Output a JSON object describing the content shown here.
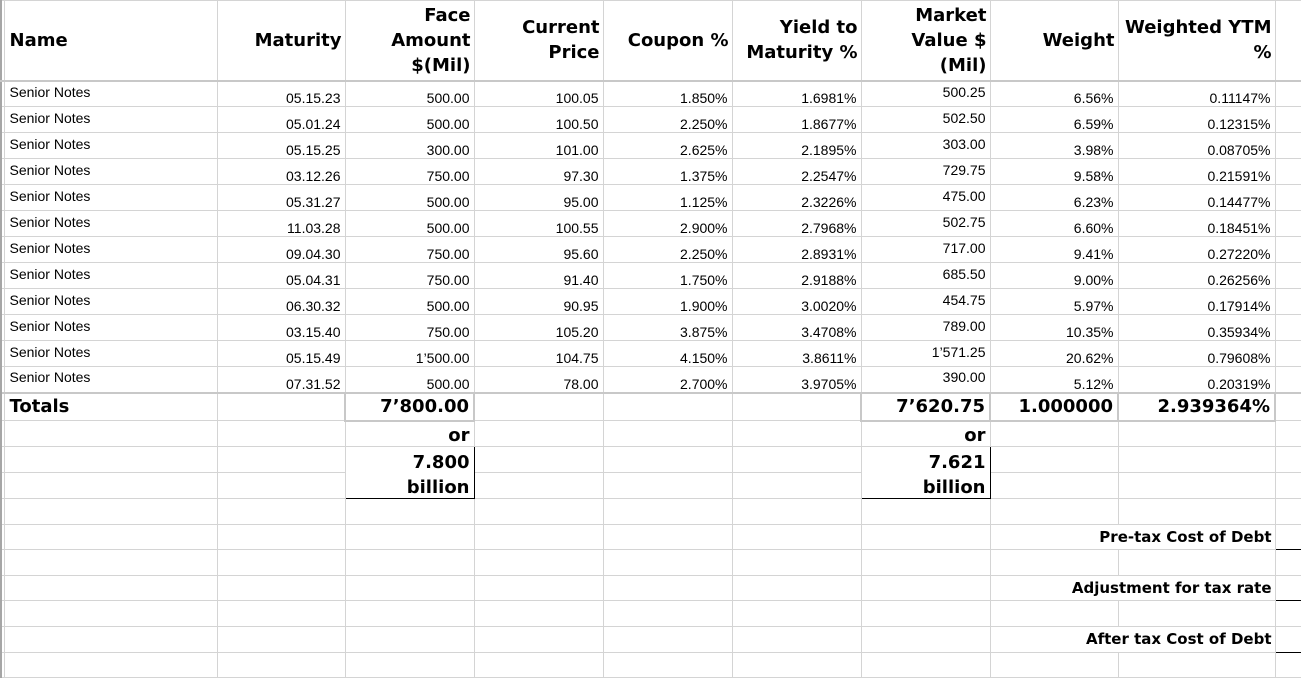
{
  "headers": {
    "name": "Name",
    "maturity": "Maturity",
    "face_amount": "Face Amount $(Mil)",
    "current_price": "Current Price",
    "coupon": "Coupon %",
    "ytm": "Yield to Maturity %",
    "market_value": "Market Value $ (Mil)",
    "weight": "Weight",
    "weighted_ytm": "Weighted YTM %"
  },
  "rows": [
    {
      "name": "Senior Notes",
      "maturity": "05.15.23",
      "face": "500.00",
      "price": "100.05",
      "coupon": "1.850%",
      "ytm": "1.6981%",
      "mv": "500.25",
      "weight": "6.56%",
      "wytm": "0.11147%"
    },
    {
      "name": "Senior Notes",
      "maturity": "05.01.24",
      "face": "500.00",
      "price": "100.50",
      "coupon": "2.250%",
      "ytm": "1.8677%",
      "mv": "502.50",
      "weight": "6.59%",
      "wytm": "0.12315%"
    },
    {
      "name": "Senior Notes",
      "maturity": "05.15.25",
      "face": "300.00",
      "price": "101.00",
      "coupon": "2.625%",
      "ytm": "2.1895%",
      "mv": "303.00",
      "weight": "3.98%",
      "wytm": "0.08705%"
    },
    {
      "name": "Senior Notes",
      "maturity": "03.12.26",
      "face": "750.00",
      "price": "97.30",
      "coupon": "1.375%",
      "ytm": "2.2547%",
      "mv": "729.75",
      "weight": "9.58%",
      "wytm": "0.21591%"
    },
    {
      "name": "Senior Notes",
      "maturity": "05.31.27",
      "face": "500.00",
      "price": "95.00",
      "coupon": "1.125%",
      "ytm": "2.3226%",
      "mv": "475.00",
      "weight": "6.23%",
      "wytm": "0.14477%"
    },
    {
      "name": "Senior Notes",
      "maturity": "11.03.28",
      "face": "500.00",
      "price": "100.55",
      "coupon": "2.900%",
      "ytm": "2.7968%",
      "mv": "502.75",
      "weight": "6.60%",
      "wytm": "0.18451%"
    },
    {
      "name": "Senior Notes",
      "maturity": "09.04.30",
      "face": "750.00",
      "price": "95.60",
      "coupon": "2.250%",
      "ytm": "2.8931%",
      "mv": "717.00",
      "weight": "9.41%",
      "wytm": "0.27220%"
    },
    {
      "name": "Senior Notes",
      "maturity": "05.04.31",
      "face": "750.00",
      "price": "91.40",
      "coupon": "1.750%",
      "ytm": "2.9188%",
      "mv": "685.50",
      "weight": "9.00%",
      "wytm": "0.26256%"
    },
    {
      "name": "Senior Notes",
      "maturity": "06.30.32",
      "face": "500.00",
      "price": "90.95",
      "coupon": "1.900%",
      "ytm": "3.0020%",
      "mv": "454.75",
      "weight": "5.97%",
      "wytm": "0.17914%"
    },
    {
      "name": "Senior Notes",
      "maturity": "03.15.40",
      "face": "750.00",
      "price": "105.20",
      "coupon": "3.875%",
      "ytm": "3.4708%",
      "mv": "789.00",
      "weight": "10.35%",
      "wytm": "0.35934%"
    },
    {
      "name": "Senior Notes",
      "maturity": "05.15.49",
      "face": "1’500.00",
      "price": "104.75",
      "coupon": "4.150%",
      "ytm": "3.8611%",
      "mv": "1’571.25",
      "weight": "20.62%",
      "wytm": "0.79608%"
    },
    {
      "name": "Senior Notes",
      "maturity": "07.31.52",
      "face": "500.00",
      "price": "78.00",
      "coupon": "2.700%",
      "ytm": "3.9705%",
      "mv": "390.00",
      "weight": "5.12%",
      "wytm": "0.20319%"
    }
  ],
  "totals": {
    "label": "Totals",
    "face": "7’800.00",
    "mv": "7’620.75",
    "weight": "1.000000",
    "wytm": "2.939364%",
    "face_or": "or",
    "face_billion_value": "7.800",
    "face_billion_unit": "billion",
    "mv_or": "or",
    "mv_billion_value": "7.621",
    "mv_billion_unit": "billion"
  },
  "cost_of_debt": {
    "pretax_label": "Pre-tax Cost of Debt",
    "pretax_value": "",
    "adjustment_label": "Adjustment for tax rate",
    "adjustment_value": "",
    "aftertax_label": "After tax Cost of Debt",
    "aftertax_value": ""
  }
}
